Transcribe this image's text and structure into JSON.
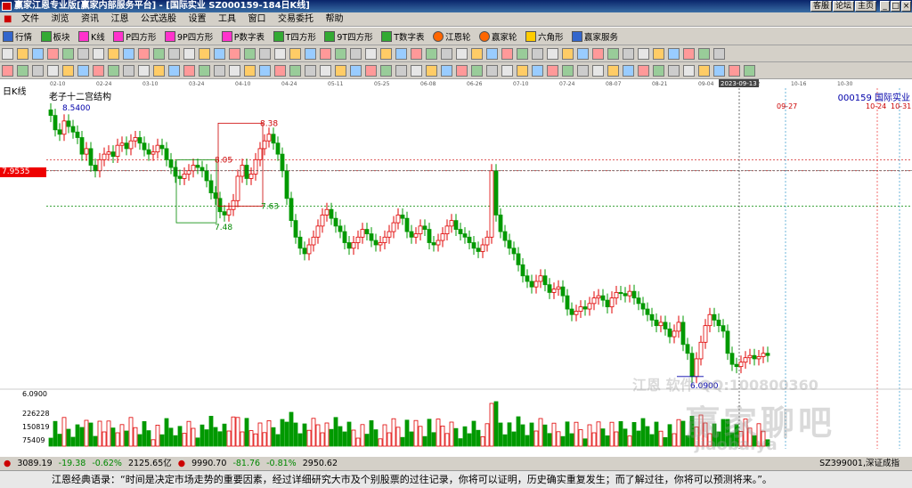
{
  "titlebar": {
    "title": "赢家江恩专业版[赢家内部服务平台] - [国际实业  SZ000159-184日K线]",
    "buttons": [
      "客服",
      "论坛",
      "主页"
    ]
  },
  "menu": [
    "文件",
    "浏览",
    "资讯",
    "江恩",
    "公式选股",
    "设置",
    "工具",
    "窗口",
    "交易委托",
    "帮助"
  ],
  "toolbar1": [
    {
      "label": "行情",
      "icon": "grid-icon"
    },
    {
      "label": "板块",
      "icon": "blocks-icon"
    },
    {
      "label": "K线",
      "icon": "kline-icon"
    },
    {
      "label": "P四方形",
      "icon": "square-icon"
    },
    {
      "label": "9P四方形",
      "icon": "square-icon"
    },
    {
      "label": "P数字表",
      "icon": "table-icon"
    },
    {
      "label": "T四方形",
      "icon": "square-icon"
    },
    {
      "label": "9T四方形",
      "icon": "square-icon"
    },
    {
      "label": "T数字表",
      "icon": "table-icon"
    },
    {
      "label": "江恩轮",
      "icon": "wheel-icon"
    },
    {
      "label": "赢家轮",
      "icon": "wheel-icon"
    },
    {
      "label": "六角形",
      "icon": "hexagon-icon"
    },
    {
      "label": "赢家服务",
      "icon": "service-icon"
    }
  ],
  "chart": {
    "period_label": "日K线",
    "structure_label": "老子十二宫结构",
    "stock": "000159 国际实业",
    "price_cursor": "7.9535",
    "vol_axis": [
      "6.0900",
      "226228",
      "150819",
      "75409"
    ],
    "date_highlight": "2023-09-13",
    "date_ticks": [
      "02-10",
      "02-24",
      "03-10",
      "03-24",
      "04-10",
      "04-24",
      "05-11",
      "05-25",
      "06-08",
      "06-26",
      "07-10",
      "07-24",
      "08-07",
      "08-21",
      "09-04",
      "10-02",
      "10-16",
      "10-30"
    ],
    "forecast_labels": [
      "09-27",
      "10-24",
      "10-31"
    ],
    "annotations": {
      "high": "8.5400",
      "box_top": "8.38",
      "box_mid": "8.05",
      "box_lo": "7.63",
      "box_bottom": "7.48",
      "low": "6.0900"
    },
    "watermark_brand": "赢家聊吧",
    "watermark_qq": "江恩      软件  QQ:100800360",
    "watermark_sub": "jiaoba.ya",
    "colors": {
      "up": "#e00000",
      "down": "#009900",
      "grid": "#c8c8c8"
    }
  },
  "chart_data": {
    "type": "candlestick",
    "note_series": "closes",
    "closes": [
      8.45,
      8.32,
      8.28,
      8.4,
      8.35,
      8.3,
      8.25,
      8.1,
      8.15,
      8.0,
      7.95,
      8.05,
      8.1,
      8.12,
      8.08,
      8.18,
      8.2,
      8.15,
      8.22,
      8.25,
      8.2,
      8.14,
      8.1,
      8.12,
      8.18,
      8.15,
      8.05,
      7.98,
      7.9,
      7.88,
      7.92,
      7.95,
      8.0,
      7.98,
      7.95,
      7.86,
      7.75,
      7.7,
      7.58,
      7.55,
      7.6,
      7.68,
      7.9,
      8.0,
      7.88,
      7.92,
      8.05,
      8.15,
      8.22,
      8.28,
      8.2,
      8.1,
      7.95,
      7.7,
      7.5,
      7.35,
      7.25,
      7.2,
      7.28,
      7.35,
      7.45,
      7.55,
      7.6,
      7.52,
      7.45,
      7.4,
      7.3,
      7.25,
      7.3,
      7.35,
      7.42,
      7.38,
      7.32,
      7.28,
      7.3,
      7.35,
      7.4,
      7.48,
      7.55,
      7.52,
      7.4,
      7.35,
      7.38,
      7.45,
      7.42,
      7.3,
      7.28,
      7.32,
      7.38,
      7.45,
      7.5,
      7.42,
      7.38,
      7.35,
      7.3,
      7.25,
      7.22,
      7.28,
      7.35,
      7.95,
      7.55,
      7.4,
      7.32,
      7.25,
      7.2,
      7.1,
      7.0,
      6.95,
      6.9,
      6.95,
      7.0,
      6.92,
      6.85,
      6.88,
      6.9,
      6.82,
      6.7,
      6.65,
      6.68,
      6.72,
      6.7,
      6.75,
      6.8,
      6.82,
      6.78,
      6.72,
      6.8,
      6.85,
      6.84,
      6.82,
      6.86,
      6.8,
      6.75,
      6.7,
      6.65,
      6.6,
      6.55,
      6.58,
      6.52,
      6.45,
      6.5,
      6.58,
      6.38,
      6.3,
      6.09,
      6.25,
      6.4,
      6.55,
      6.65,
      6.6,
      6.55,
      6.5,
      6.3,
      6.2,
      6.18,
      6.22,
      6.26,
      6.28,
      6.25,
      6.27,
      6.3,
      6.28
    ]
  },
  "status": {
    "sh": "3089.19",
    "sh_chg": "-19.38",
    "sh_pct": "-0.62%",
    "sh_amt": "2125.65亿",
    "sz": "9990.70",
    "sz_chg": "-81.76",
    "sz_pct": "-0.81%",
    "sz_amt": "2950.62",
    "right": "SZ399001,深证成指"
  },
  "quote": "江恩经典语录：“时间是决定市场走势的重要因素，经过详细研究大市及个别股票的过往记录，你将可以证明，历史确实重复发生；而了解过往，你将可以预测将来。”。"
}
